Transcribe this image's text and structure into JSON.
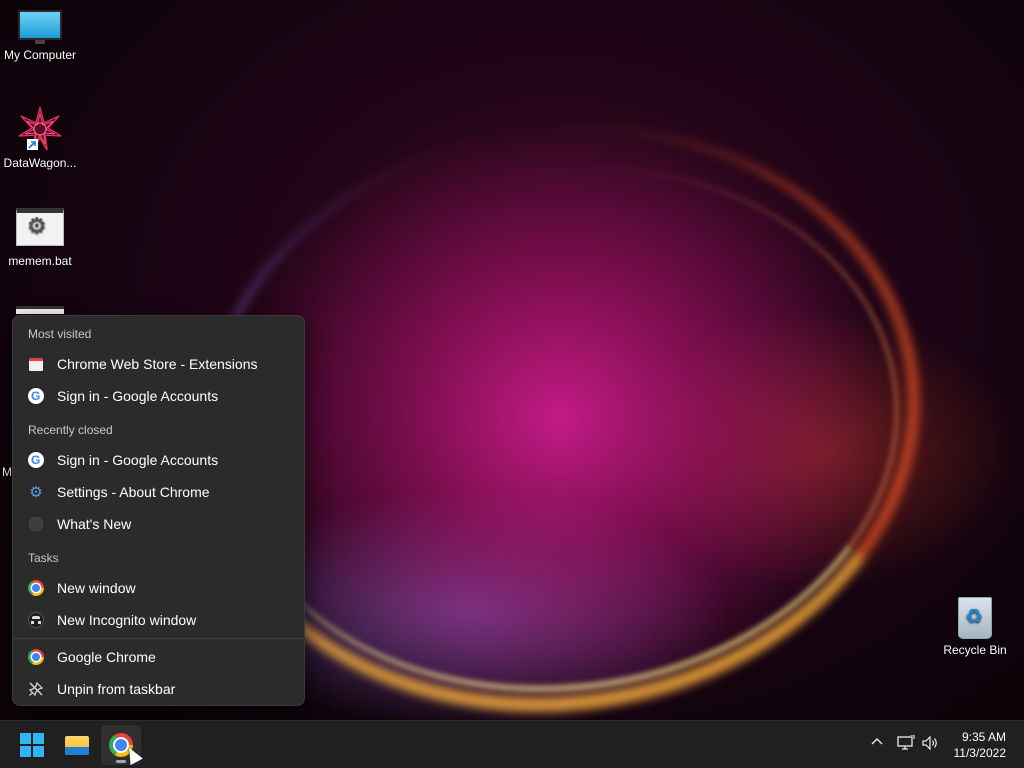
{
  "desktop": {
    "icons": [
      {
        "label": "My Computer",
        "icon": "monitor-icon"
      },
      {
        "label": "DataWagon...",
        "icon": "star-shortcut-icon"
      },
      {
        "label": "memem.bat",
        "icon": "batch-file-icon"
      },
      {
        "label": "Recycle Bin",
        "icon": "recycle-bin-icon"
      }
    ],
    "partial_letter": "M"
  },
  "jumplist": {
    "most_visited_header": "Most visited",
    "most_visited": [
      {
        "label": "Chrome Web Store - Extensions",
        "icon": "chrome-web-store-icon"
      },
      {
        "label": "Sign in - Google Accounts",
        "icon": "google-icon"
      }
    ],
    "recently_closed_header": "Recently closed",
    "recently_closed": [
      {
        "label": "Sign in - Google Accounts",
        "icon": "google-icon"
      },
      {
        "label": "Settings - About Chrome",
        "icon": "gear-icon"
      },
      {
        "label": "What's New",
        "icon": "circle-icon"
      }
    ],
    "tasks_header": "Tasks",
    "tasks": [
      {
        "label": "New window",
        "icon": "chrome-icon"
      },
      {
        "label": "New Incognito window",
        "icon": "incognito-icon"
      }
    ],
    "pinned": [
      {
        "label": "Google Chrome",
        "icon": "chrome-icon"
      },
      {
        "label": "Unpin from taskbar",
        "icon": "unpin-icon"
      }
    ]
  },
  "taskbar": {
    "buttons": [
      {
        "name": "start",
        "icon": "windows-logo-icon"
      },
      {
        "name": "file-explorer",
        "icon": "folder-icon"
      },
      {
        "name": "chrome",
        "icon": "chrome-icon",
        "active": true
      }
    ],
    "tray": {
      "icons": [
        "chevron-up-icon",
        "network-icon",
        "volume-icon"
      ]
    },
    "clock": {
      "time": "9:35 AM",
      "date": "11/3/2022"
    }
  },
  "colors": {
    "accent": "#2fb7f5",
    "taskbar_bg": "#202020",
    "menu_bg": "#2b2b2b"
  }
}
